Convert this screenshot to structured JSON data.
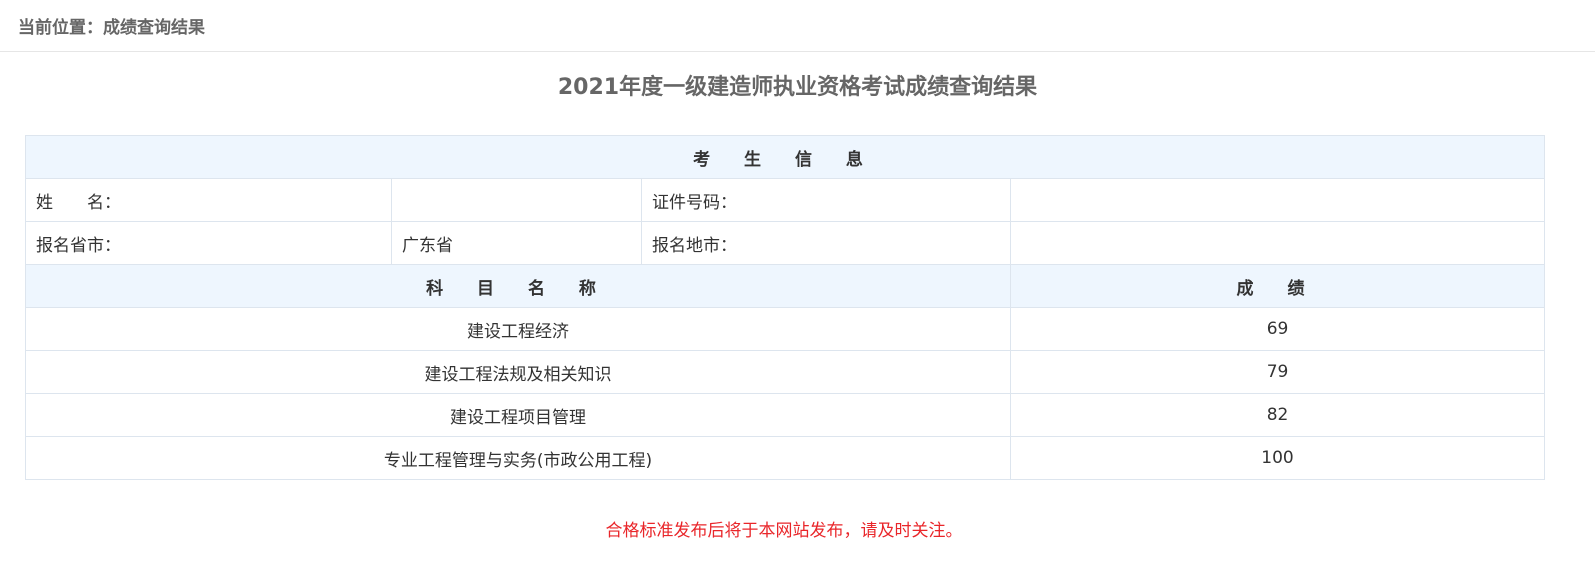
{
  "breadcrumb": {
    "text": "当前位置：成绩查询结果"
  },
  "page_title": "2021年度一级建造师执业资格考试成绩查询结果",
  "candidate_info": {
    "header": "考 生 信 息",
    "name_label": "姓　　名：",
    "name_value": "",
    "id_label": "证件号码：",
    "id_value": "",
    "province_label": "报名省市：",
    "province_value": "广东省",
    "city_label": "报名地市：",
    "city_value": ""
  },
  "scores": {
    "subject_header": "科 目 名 称",
    "score_header": "成 绩",
    "rows": [
      {
        "subject": "建设工程经济",
        "score": "69"
      },
      {
        "subject": "建设工程法规及相关知识",
        "score": "79"
      },
      {
        "subject": "建设工程项目管理",
        "score": "82"
      },
      {
        "subject": "专业工程管理与实务(市政公用工程)",
        "score": "100"
      }
    ]
  },
  "notice": "合格标准发布后将于本网站发布，请及时关注。",
  "colors": {
    "header_bg": "#eef6fe",
    "border": "#dde5ee",
    "notice": "#e9262a",
    "title": "#666666"
  }
}
